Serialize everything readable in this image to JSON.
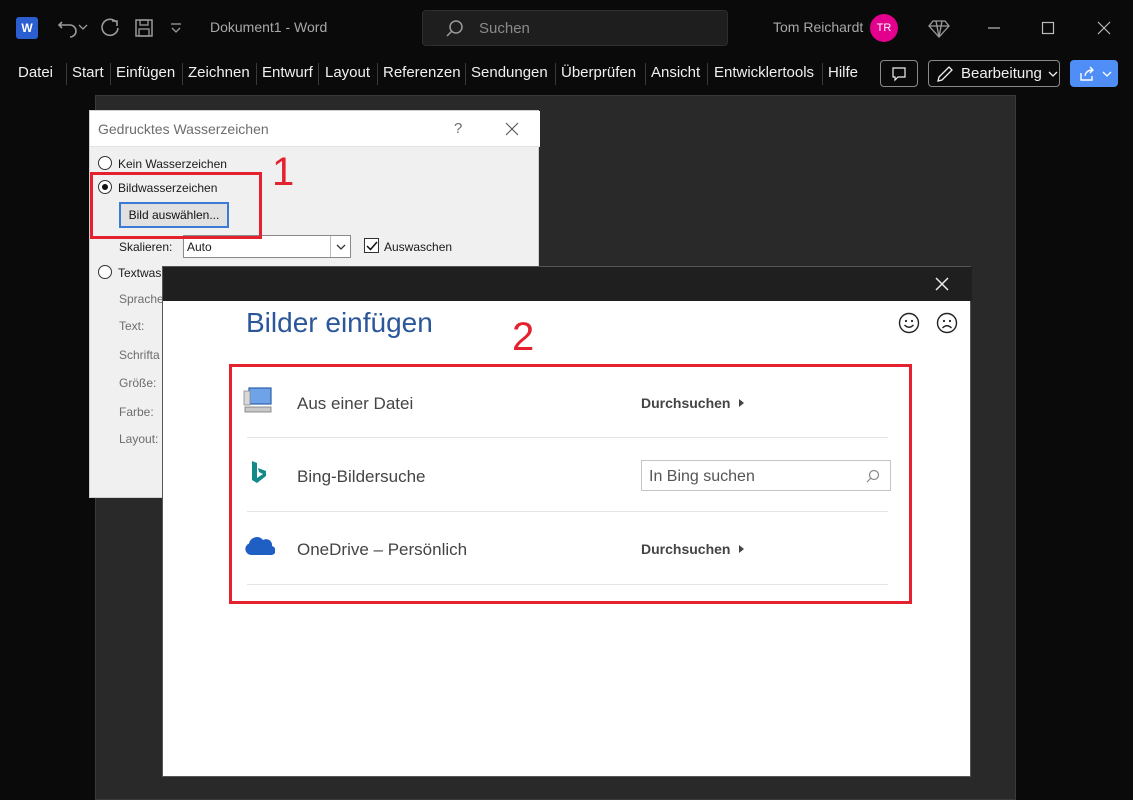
{
  "titlebar": {
    "app_logo": "W",
    "doc_title": "Dokument1  -  Word",
    "search_placeholder": "Suchen",
    "user_name": "Tom Reichardt",
    "avatar_initials": "TR"
  },
  "menu": {
    "items": [
      "Datei",
      "Start",
      "Einfügen",
      "Zeichnen",
      "Entwurf",
      "Layout",
      "Referenzen",
      "Sendungen",
      "Überprüfen",
      "Ansicht",
      "Entwicklertools",
      "Hilfe"
    ],
    "edit_mode_label": "Bearbeitung"
  },
  "watermark_dialog": {
    "title": "Gedrucktes Wasserzeichen",
    "help": "?",
    "option_none": "Kein Wasserzeichen",
    "option_picture": "Bildwasserzeichen",
    "select_picture_button": "Bild auswählen...",
    "scale_label": "Skalieren:",
    "scale_value": "Auto",
    "washout_label": "Auswaschen",
    "option_text": "Textwass",
    "field_language": "Sprache",
    "field_text": "Text:",
    "field_font": "Schrifta",
    "field_size": "Größe:",
    "field_color": "Farbe:",
    "field_layout": "Layout:"
  },
  "insert_dialog": {
    "title": "Bilder einfügen",
    "rows": [
      {
        "label": "Aus einer Datei",
        "action": "Durchsuchen"
      },
      {
        "label": "Bing-Bildersuche",
        "input_placeholder": "In Bing suchen"
      },
      {
        "label": "OneDrive – Persönlich",
        "action": "Durchsuchen"
      }
    ]
  },
  "annotations": {
    "step1": "1",
    "step2": "2"
  },
  "colors": {
    "annotation_red": "#e4222f",
    "word_blue": "#2b579a",
    "avatar_pink": "#e3008c",
    "share_blue": "#4f8ef7"
  }
}
